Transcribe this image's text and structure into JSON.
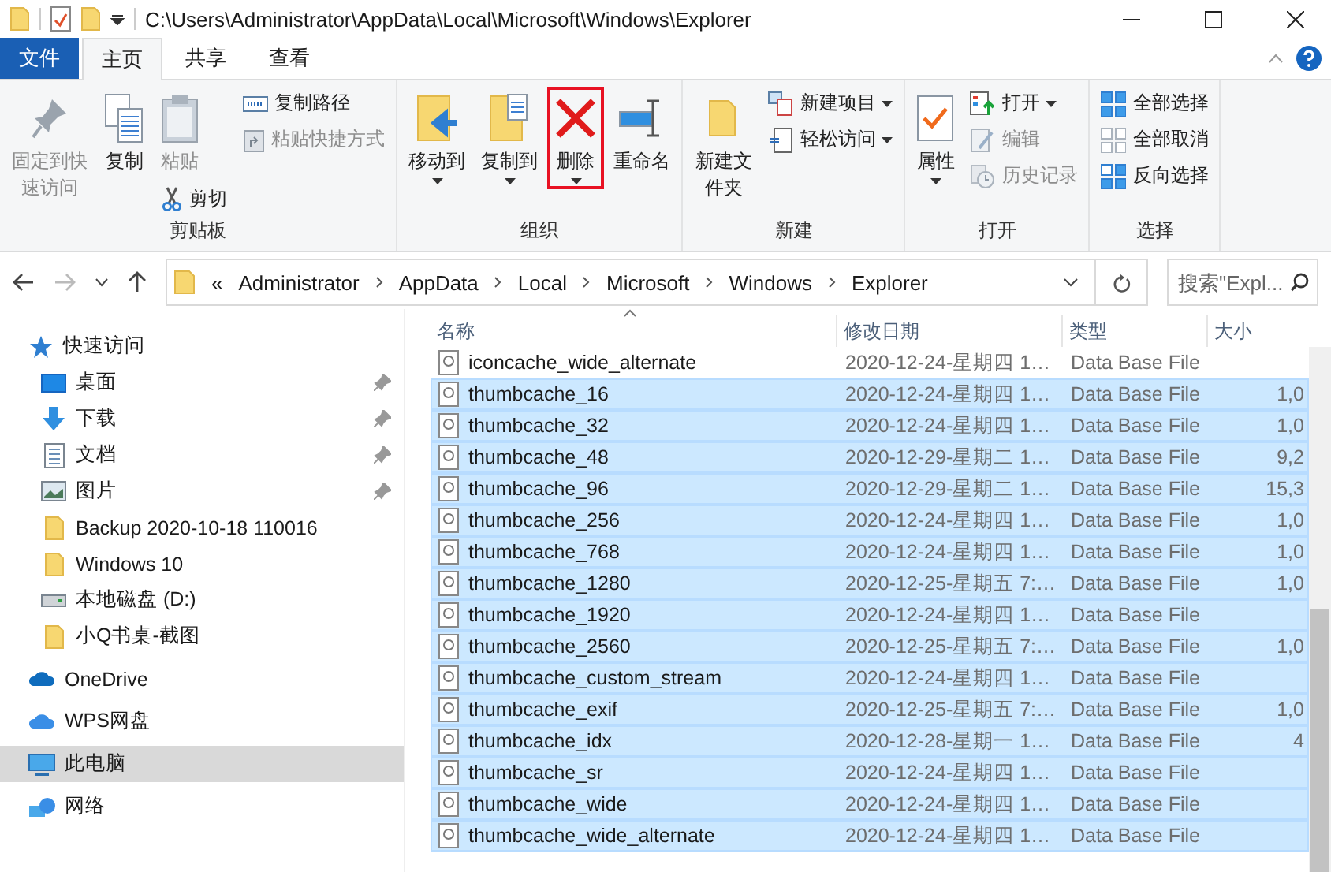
{
  "window": {
    "title": "C:\\Users\\Administrator\\AppData\\Local\\Microsoft\\Windows\\Explorer"
  },
  "tabs": [
    {
      "label": "文件",
      "kind": "file",
      "selected": false
    },
    {
      "label": "主页",
      "kind": "tab",
      "selected": true
    },
    {
      "label": "共享",
      "kind": "tab",
      "selected": false
    },
    {
      "label": "查看",
      "kind": "tab",
      "selected": false
    }
  ],
  "ribbon": {
    "groups": [
      {
        "label": "剪贴板",
        "columns": [
          [
            {
              "label": "固定到快速访问",
              "kind": "large",
              "dropdown": false,
              "disabled": true,
              "highlighted": false
            }
          ],
          [
            {
              "label": "复制",
              "kind": "large",
              "dropdown": false,
              "disabled": false,
              "highlighted": false
            }
          ],
          [
            {
              "label": "粘贴",
              "kind": "large",
              "dropdown": false,
              "disabled": true,
              "highlighted": false
            },
            {
              "label": "剪切",
              "kind": "small",
              "dropdown": false,
              "disabled": false,
              "highlighted": false
            }
          ],
          [
            {
              "label": "复制路径",
              "kind": "small",
              "dropdown": false,
              "disabled": false,
              "highlighted": false
            },
            {
              "label": "粘贴快捷方式",
              "kind": "small",
              "dropdown": false,
              "disabled": true,
              "highlighted": false
            }
          ]
        ]
      },
      {
        "label": "组织",
        "columns": [
          [
            {
              "label": "移动到",
              "kind": "large",
              "dropdown": true,
              "disabled": false,
              "highlighted": false
            }
          ],
          [
            {
              "label": "复制到",
              "kind": "large",
              "dropdown": true,
              "disabled": false,
              "highlighted": false
            }
          ],
          [
            {
              "label": "删除",
              "kind": "large",
              "dropdown": true,
              "disabled": false,
              "highlighted": true
            }
          ],
          [
            {
              "label": "重命名",
              "kind": "large",
              "dropdown": false,
              "disabled": false,
              "highlighted": false
            }
          ]
        ]
      },
      {
        "label": "新建",
        "columns": [
          [
            {
              "label": "新建文件夹",
              "kind": "large",
              "dropdown": false,
              "disabled": false,
              "highlighted": false
            }
          ],
          [
            {
              "label": "新建项目",
              "kind": "small",
              "dropdown": true,
              "disabled": false,
              "highlighted": false
            },
            {
              "label": "轻松访问",
              "kind": "small",
              "dropdown": true,
              "disabled": false,
              "highlighted": false
            }
          ]
        ]
      },
      {
        "label": "打开",
        "columns": [
          [
            {
              "label": "属性",
              "kind": "large",
              "dropdown": true,
              "disabled": false,
              "highlighted": false
            }
          ],
          [
            {
              "label": "打开",
              "kind": "small",
              "dropdown": true,
              "disabled": false,
              "highlighted": false
            },
            {
              "label": "编辑",
              "kind": "small",
              "dropdown": false,
              "disabled": true,
              "highlighted": false
            },
            {
              "label": "历史记录",
              "kind": "small",
              "dropdown": false,
              "disabled": true,
              "highlighted": false
            }
          ]
        ]
      },
      {
        "label": "选择",
        "columns": [
          [
            {
              "label": "全部选择",
              "kind": "small",
              "dropdown": false,
              "disabled": false,
              "highlighted": false
            },
            {
              "label": "全部取消",
              "kind": "small",
              "dropdown": false,
              "disabled": false,
              "highlighted": false
            },
            {
              "label": "反向选择",
              "kind": "small",
              "dropdown": false,
              "disabled": false,
              "highlighted": false
            }
          ]
        ]
      }
    ]
  },
  "address": {
    "overflow": "«",
    "crumbs": [
      "Administrator",
      "AppData",
      "Local",
      "Microsoft",
      "Windows",
      "Explorer"
    ]
  },
  "search": {
    "placeholder": "搜索\"Expl..."
  },
  "sidebar": {
    "items": [
      {
        "label": "快速访问",
        "selected": false,
        "children": [
          {
            "label": "桌面",
            "pinned": true,
            "selected": false
          },
          {
            "label": "下载",
            "pinned": true,
            "selected": false
          },
          {
            "label": "文档",
            "pinned": true,
            "selected": false
          },
          {
            "label": "图片",
            "pinned": true,
            "selected": false
          },
          {
            "label": "Backup 2020-10-18 110016",
            "pinned": false,
            "selected": false
          },
          {
            "label": "Windows 10",
            "pinned": false,
            "selected": false
          },
          {
            "label": "本地磁盘 (D:)",
            "pinned": false,
            "selected": false
          },
          {
            "label": "小Q书桌-截图",
            "pinned": false,
            "selected": false
          }
        ]
      },
      {
        "label": "OneDrive",
        "selected": false
      },
      {
        "label": "WPS网盘",
        "selected": false
      },
      {
        "label": "此电脑",
        "selected": true
      },
      {
        "label": "网络",
        "selected": false
      }
    ]
  },
  "table": {
    "columns": [
      "名称",
      "修改日期",
      "类型",
      "大小"
    ],
    "rows": [
      {
        "name": "iconcache_wide_alternate",
        "date": "2020-12-24-星期四 1…",
        "type": "Data Base File",
        "selected": false
      },
      {
        "name": "thumbcache_16",
        "date": "2020-12-24-星期四 1…",
        "type": "Data Base File",
        "size": "1,0",
        "selected": true
      },
      {
        "name": "thumbcache_32",
        "date": "2020-12-24-星期四 1…",
        "type": "Data Base File",
        "size": "1,0",
        "selected": true
      },
      {
        "name": "thumbcache_48",
        "date": "2020-12-29-星期二 1…",
        "type": "Data Base File",
        "size": "9,2",
        "selected": true
      },
      {
        "name": "thumbcache_96",
        "date": "2020-12-29-星期二 1…",
        "type": "Data Base File",
        "size": "15,3",
        "selected": true
      },
      {
        "name": "thumbcache_256",
        "date": "2020-12-24-星期四 1…",
        "type": "Data Base File",
        "size": "1,0",
        "selected": true
      },
      {
        "name": "thumbcache_768",
        "date": "2020-12-24-星期四 1…",
        "type": "Data Base File",
        "size": "1,0",
        "selected": true
      },
      {
        "name": "thumbcache_1280",
        "date": "2020-12-25-星期五 7:…",
        "type": "Data Base File",
        "size": "1,0",
        "selected": true
      },
      {
        "name": "thumbcache_1920",
        "date": "2020-12-24-星期四 1…",
        "type": "Data Base File",
        "selected": true
      },
      {
        "name": "thumbcache_2560",
        "date": "2020-12-25-星期五 7:…",
        "type": "Data Base File",
        "size": "1,0",
        "selected": true
      },
      {
        "name": "thumbcache_custom_stream",
        "date": "2020-12-24-星期四 1…",
        "type": "Data Base File",
        "selected": true
      },
      {
        "name": "thumbcache_exif",
        "date": "2020-12-25-星期五 7:…",
        "type": "Data Base File",
        "size": "1,0",
        "selected": true
      },
      {
        "name": "thumbcache_idx",
        "date": "2020-12-28-星期一 1…",
        "type": "Data Base File",
        "size": "4",
        "selected": true
      },
      {
        "name": "thumbcache_sr",
        "date": "2020-12-24-星期四 1…",
        "type": "Data Base File",
        "selected": true
      },
      {
        "name": "thumbcache_wide",
        "date": "2020-12-24-星期四 1…",
        "type": "Data Base File",
        "selected": true
      },
      {
        "name": "thumbcache_wide_alternate",
        "date": "2020-12-24-星期四 1…",
        "type": "Data Base File",
        "selected": true
      }
    ]
  }
}
